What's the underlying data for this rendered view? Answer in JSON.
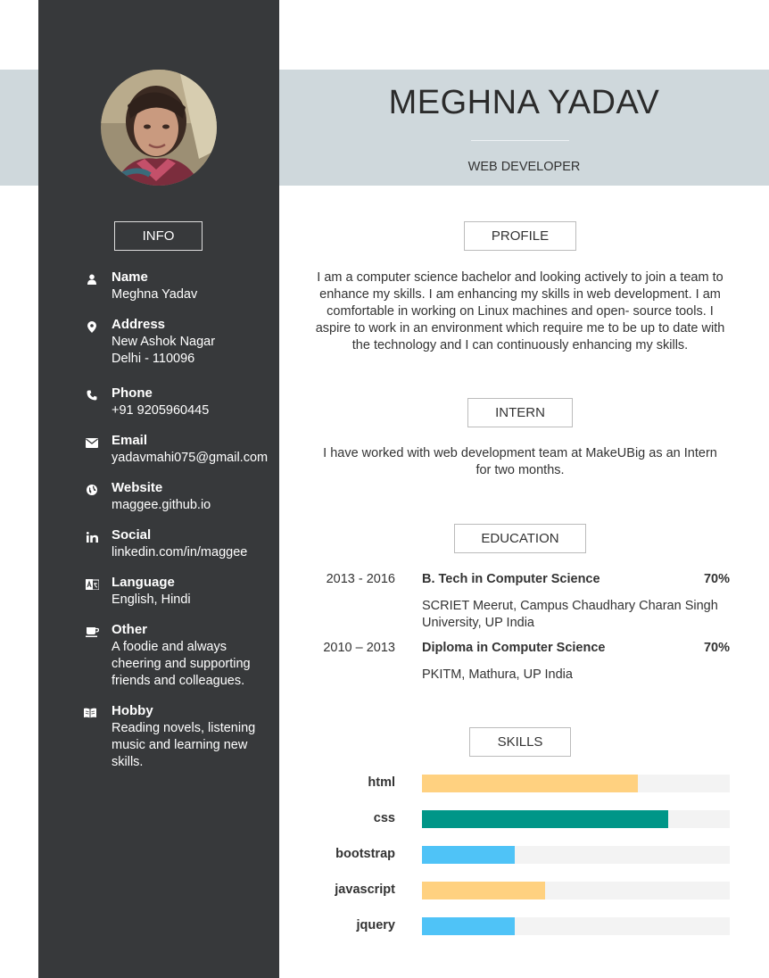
{
  "header": {
    "name": "MEGHNA YADAV",
    "role": "WEB DEVELOPER",
    "band_color": "#cfd8dc"
  },
  "sidebar": {
    "bg_color": "#37393b",
    "info_title": "INFO",
    "items": [
      {
        "icon": "user-icon",
        "label": "Name",
        "value": "Meghna Yadav"
      },
      {
        "icon": "map-pin-icon",
        "label": "Address",
        "value": "New Ashok Nagar Delhi - 110096"
      },
      {
        "icon": "phone-icon",
        "label": "Phone",
        "value": "+91 9205960445"
      },
      {
        "icon": "envelope-icon",
        "label": "Email",
        "value": "yadavmahi075@gmail.com"
      },
      {
        "icon": "globe-icon",
        "label": "Website",
        "value": "maggee.github.io"
      },
      {
        "icon": "linkedin-icon",
        "label": "Social",
        "value": "linkedin.com/in/maggee"
      },
      {
        "icon": "language-icon",
        "label": "Language",
        "value": "English, Hindi"
      },
      {
        "icon": "coffee-icon",
        "label": "Other",
        "value": "A foodie and always cheering and supporting friends and colleagues."
      },
      {
        "icon": "book-icon",
        "label": "Hobby",
        "value": "Reading novels, listening music and learning new skills."
      }
    ]
  },
  "profile": {
    "title": "PROFILE",
    "text": "I am a computer science bachelor and looking actively to join a team to enhance my skills. I am enhancing my skills in web development. I am comfortable in working on Linux machines and open- source tools. I aspire to work in an environment which require me to be up to date with the technology and I can continuously enhancing my skills."
  },
  "intern": {
    "title": "INTERN",
    "text": "I have worked with web development team at MakeUBig as an Intern for two months."
  },
  "education": {
    "title": "EDUCATION",
    "entries": [
      {
        "years": "2013 - 2016",
        "degree": "B. Tech in Computer Science",
        "percent": "70%",
        "school": "SCRIET Meerut, Campus Chaudhary Charan Singh University, UP India"
      },
      {
        "years": "2010 – 2013",
        "degree": "Diploma in Computer Science",
        "percent": "70%",
        "school": "PKITM, Mathura, UP India"
      }
    ]
  },
  "skills": {
    "title": "SKILLS",
    "items": [
      {
        "name": "html",
        "level": 0.7,
        "color": "#ffd180"
      },
      {
        "name": "css",
        "level": 0.8,
        "color": "#009688"
      },
      {
        "name": "bootstrap",
        "level": 0.3,
        "color": "#4fc3f7"
      },
      {
        "name": "javascript",
        "level": 0.4,
        "color": "#ffd180"
      },
      {
        "name": "jquery",
        "level": 0.3,
        "color": "#4fc3f7"
      }
    ]
  }
}
